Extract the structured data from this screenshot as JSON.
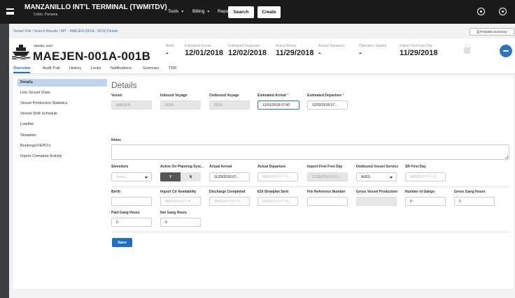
{
  "app": {
    "title": "MANZANILLO INT'L TERMINAL (TWMITDV)",
    "subtitle": "Colón, Panama",
    "menu": {
      "tools": "Tools",
      "billing": "Billing",
      "reports": "Reports"
    },
    "search_label": "Search",
    "create_label": "Create",
    "icons": {
      "menu": "hamburger-icon",
      "settings": "gear-icon",
      "account": "user-icon"
    }
  },
  "breadcrumb": {
    "part1": "Vessel Visit",
    "sep": " / ",
    "part2": "Search Results",
    "current": "MIT - MAEJEN (001A - 0018) Details"
  },
  "printable_summary": "Printable Summary",
  "vessel": {
    "label": "VESSEL VISIT",
    "name": "MAEJEN-001A-001B",
    "stats": [
      {
        "label": "Berth",
        "value": "-"
      },
      {
        "label": "Estimated Arrival",
        "value": "12/01/2018"
      },
      {
        "label": "Estimated Departure",
        "value": "12/02/2018"
      },
      {
        "label": "Actual Arrival",
        "value": "11/29/2018"
      },
      {
        "label": "Actual Departure",
        "value": "-"
      },
      {
        "label": "Operation Started",
        "value": "-"
      },
      {
        "label": "Import First Free Day",
        "value": "11/29/2018"
      }
    ]
  },
  "tabs": [
    "Overview",
    "Audit Trail",
    "History",
    "Locks",
    "Notifications",
    "Summary",
    "TDR"
  ],
  "sidebar": [
    "Details",
    "Line Vessel Visits",
    "Vessel Production Statistics",
    "Vessel Shift Schedule",
    "Loadlist",
    "Stowplan",
    "Bookings/VEPO's",
    "Import Container Activity"
  ],
  "details": {
    "title": "Details",
    "vessel": {
      "label": "Vessel",
      "value": "MAEJEN"
    },
    "inbound_voyage": {
      "label": "Inbound Voyage",
      "value": "001A"
    },
    "outbound_voyage": {
      "label": "Outbound Voyage",
      "value": "0018"
    },
    "est_arrival": {
      "label": "Estimated Arrival",
      "required": "*",
      "value": "12/01/2018 07:00"
    },
    "est_departure": {
      "label": "Estimated Departure",
      "required": "*",
      "value": "12/02/2018 07..."
    },
    "notes_label": "Notes",
    "stevedore": {
      "label": "Stevedore",
      "placeholder": "Select..."
    },
    "active_planning": {
      "label": "Active On Planning Syst...",
      "yes": "Y",
      "no": "N"
    },
    "actual_arrival": {
      "label": "Actual Arrival",
      "value": "11/29/2018 07..."
    },
    "actual_departure": {
      "label": "Actual Departure",
      "placeholder": "MM/DD/YYYY H..."
    },
    "import_first_free_day": {
      "label": "Import First Free Day",
      "value": "11/29/2018 07:0..."
    },
    "outbound_service": {
      "label": "Outbound Vessel Service",
      "value": "AVES"
    },
    "sr_first_day": {
      "label": "SR First Day",
      "placeholder": "MM/DD/YYYY H..."
    },
    "berth": {
      "label": "Berth",
      "value": ""
    },
    "import_ctr_availability": {
      "label": "Import Ctr Availability",
      "placeholder": "MM/DD/YYYY H..."
    },
    "discharge_completed": {
      "label": "Discharge Completed",
      "placeholder": "MM/DD/YYYY H..."
    },
    "edi_stowplan_sent": {
      "label": "EDI Stowplan Sent",
      "placeholder": "MM/DD/YYYY H..."
    },
    "file_reference_number": {
      "label": "File Reference Number",
      "value": ""
    },
    "gross_vessel_production": {
      "label": "Gross Vessel Production",
      "value": ""
    },
    "number_of_gangs": {
      "label": "Number of Gangs",
      "value": "0"
    },
    "gross_gang_hours": {
      "label": "Gross Gang Hours",
      "value": "0"
    },
    "paid_gang_hours": {
      "label": "Paid Gang Hours",
      "value": "0"
    },
    "net_gang_hours": {
      "label": "Net Gang Hours",
      "value": "0"
    },
    "save_label": "Save"
  },
  "colors": {
    "topbar": "#1a1a1a",
    "accent": "#1d6fc6",
    "sidebar_active": "#bfd6ec"
  }
}
